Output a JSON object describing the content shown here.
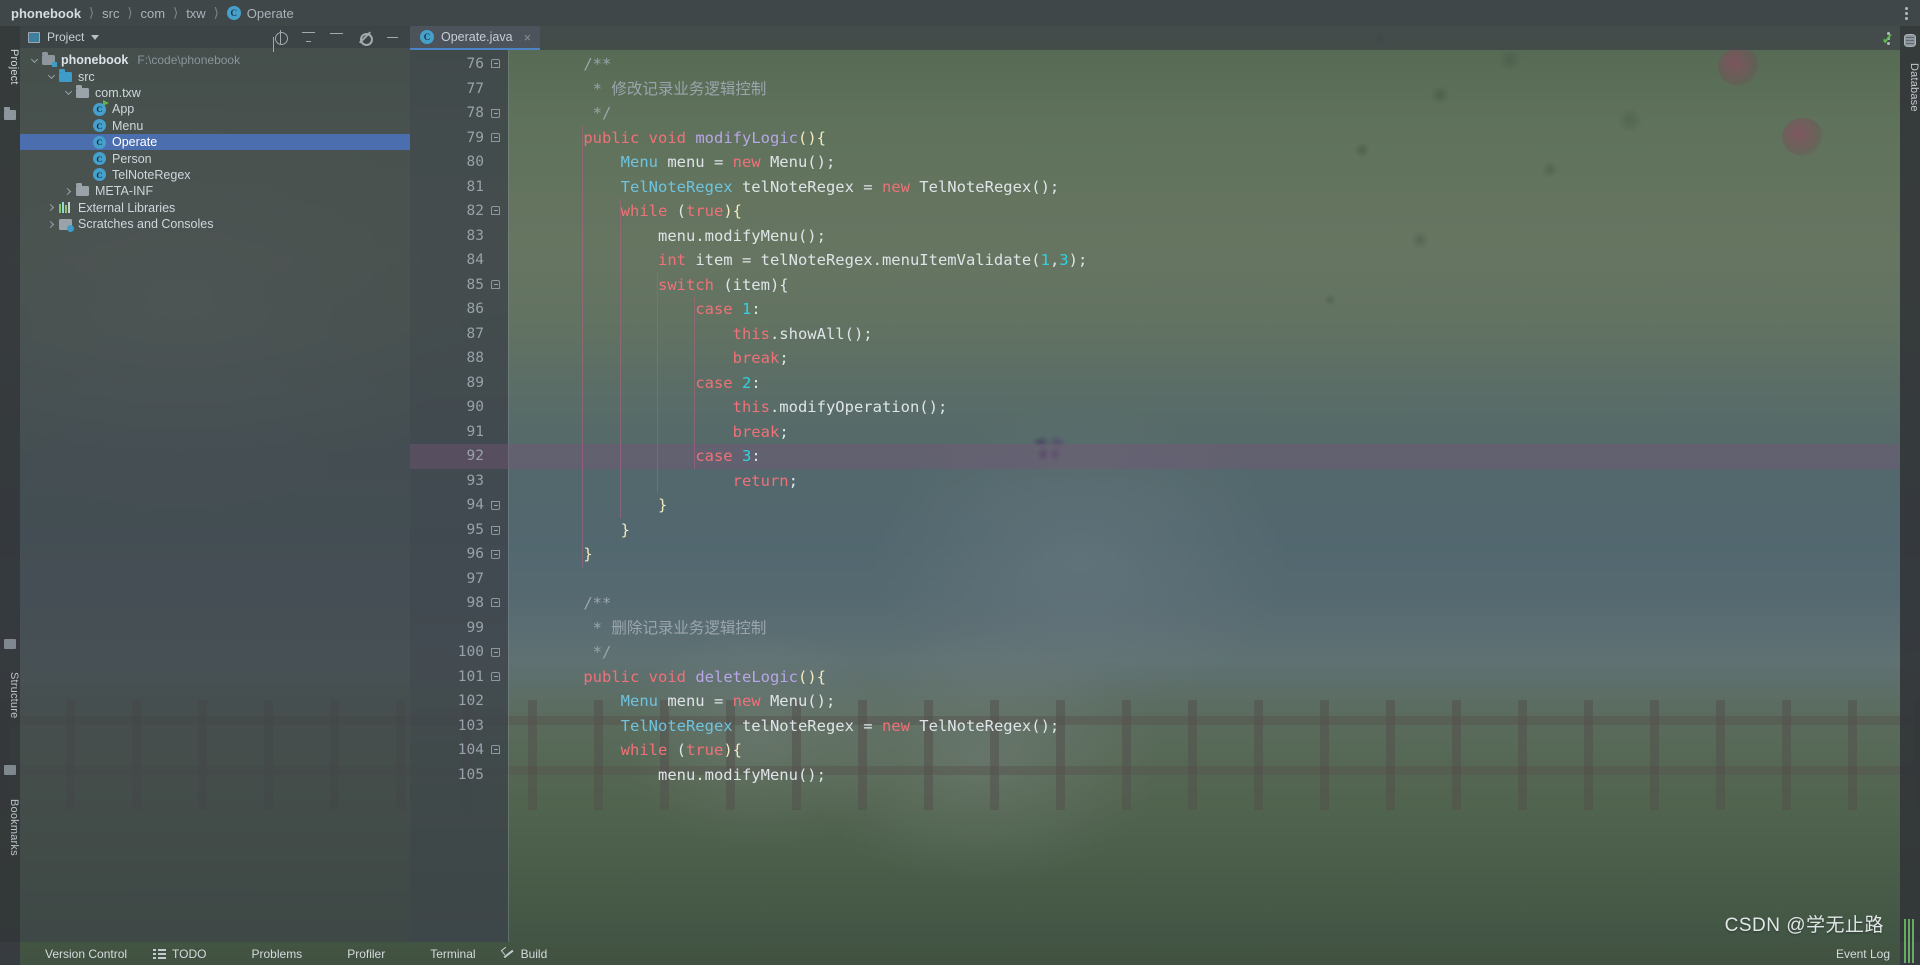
{
  "breadcrumb": {
    "items": [
      "phonebook",
      "src",
      "com",
      "txw"
    ],
    "class_item": "Operate",
    "class_icon": "class-icon"
  },
  "left_strip": {
    "project_label": "Project",
    "structure_label": "Structure",
    "bookmarks_label": "Bookmarks"
  },
  "right_strip": {
    "database_label": "Database",
    "database_icon": "database-icon"
  },
  "project_panel": {
    "title": "Project",
    "tools": [
      "locate-icon",
      "collapse-all-icon",
      "expand-icon",
      "settings-icon",
      "hide-icon"
    ],
    "tree": [
      {
        "label": "phonebook",
        "path": "F:\\code\\phonebook",
        "indent": 0,
        "twisty": "open",
        "icon": "module-folder-icon",
        "bold": true,
        "selected": false
      },
      {
        "label": "src",
        "path": "",
        "indent": 1,
        "twisty": "open",
        "icon": "source-folder-icon",
        "bold": false,
        "selected": false
      },
      {
        "label": "com.txw",
        "path": "",
        "indent": 2,
        "twisty": "open",
        "icon": "package-icon",
        "bold": false,
        "selected": false
      },
      {
        "label": "App",
        "path": "",
        "indent": 3,
        "twisty": "none",
        "icon": "class-runnable-icon",
        "bold": false,
        "selected": false
      },
      {
        "label": "Menu",
        "path": "",
        "indent": 3,
        "twisty": "none",
        "icon": "class-icon",
        "bold": false,
        "selected": false
      },
      {
        "label": "Operate",
        "path": "",
        "indent": 3,
        "twisty": "none",
        "icon": "class-icon",
        "bold": false,
        "selected": true
      },
      {
        "label": "Person",
        "path": "",
        "indent": 3,
        "twisty": "none",
        "icon": "class-icon",
        "bold": false,
        "selected": false
      },
      {
        "label": "TelNoteRegex",
        "path": "",
        "indent": 3,
        "twisty": "none",
        "icon": "class-icon",
        "bold": false,
        "selected": false
      },
      {
        "label": "META-INF",
        "path": "",
        "indent": 2,
        "twisty": "closed",
        "icon": "folder-icon",
        "bold": false,
        "selected": false
      },
      {
        "label": "External Libraries",
        "path": "",
        "indent": 1,
        "twisty": "closed",
        "icon": "libraries-icon",
        "bold": false,
        "selected": false
      },
      {
        "label": "Scratches and Consoles",
        "path": "",
        "indent": 1,
        "twisty": "closed",
        "icon": "scratches-icon",
        "bold": false,
        "selected": false
      }
    ]
  },
  "editor": {
    "tab": {
      "label": "Operate.java",
      "icon": "class-icon",
      "close": "×"
    },
    "more_icon": "more-vertical-icon",
    "inspection_status": "✓",
    "first_line_number": 76,
    "caret_line": 92,
    "lines": [
      {
        "n": 76,
        "fold": "cap-top",
        "indent": 0,
        "tokens": [
          {
            "t": "    ",
            "c": "plain"
          },
          {
            "t": "/**",
            "c": "cmt"
          }
        ]
      },
      {
        "n": 77,
        "fold": "",
        "indent": 0,
        "tokens": [
          {
            "t": "     * 修改记录业务逻辑控制",
            "c": "cmt"
          }
        ]
      },
      {
        "n": 78,
        "fold": "cap-bot",
        "indent": 0,
        "tokens": [
          {
            "t": "     */",
            "c": "cmt"
          }
        ]
      },
      {
        "n": 79,
        "fold": "cap-top",
        "indent": 0,
        "tokens": [
          {
            "t": "    ",
            "c": "plain"
          },
          {
            "t": "public",
            "c": "kw"
          },
          {
            "t": " ",
            "c": "plain"
          },
          {
            "t": "void",
            "c": "kw"
          },
          {
            "t": " ",
            "c": "plain"
          },
          {
            "t": "modifyLogic",
            "c": "mth"
          },
          {
            "t": "(){",
            "c": "brc"
          }
        ]
      },
      {
        "n": 80,
        "fold": "",
        "indent": 1,
        "tokens": [
          {
            "t": "        ",
            "c": "plain"
          },
          {
            "t": "Menu",
            "c": "cls"
          },
          {
            "t": " menu = ",
            "c": "plain"
          },
          {
            "t": "new",
            "c": "kw"
          },
          {
            "t": " Menu();",
            "c": "plain"
          }
        ]
      },
      {
        "n": 81,
        "fold": "",
        "indent": 1,
        "tokens": [
          {
            "t": "        ",
            "c": "plain"
          },
          {
            "t": "TelNoteRegex",
            "c": "cls"
          },
          {
            "t": " telNoteRegex = ",
            "c": "plain"
          },
          {
            "t": "new",
            "c": "kw"
          },
          {
            "t": " TelNoteRegex();",
            "c": "plain"
          }
        ]
      },
      {
        "n": 82,
        "fold": "cap-top",
        "indent": 1,
        "tokens": [
          {
            "t": "        ",
            "c": "plain"
          },
          {
            "t": "while",
            "c": "kw"
          },
          {
            "t": " (",
            "c": "plain"
          },
          {
            "t": "true",
            "c": "kw"
          },
          {
            "t": "){",
            "c": "brc"
          }
        ]
      },
      {
        "n": 83,
        "fold": "",
        "indent": 2,
        "tokens": [
          {
            "t": "            menu.modifyMenu();",
            "c": "plain"
          }
        ]
      },
      {
        "n": 84,
        "fold": "",
        "indent": 2,
        "tokens": [
          {
            "t": "            ",
            "c": "plain"
          },
          {
            "t": "int",
            "c": "kw"
          },
          {
            "t": " item = telNoteRegex.menuItemValidate(",
            "c": "plain"
          },
          {
            "t": "1",
            "c": "num"
          },
          {
            "t": ",",
            "c": "plain"
          },
          {
            "t": "3",
            "c": "num"
          },
          {
            "t": ");",
            "c": "plain"
          }
        ]
      },
      {
        "n": 85,
        "fold": "cap-top",
        "indent": 2,
        "tokens": [
          {
            "t": "            ",
            "c": "plain"
          },
          {
            "t": "switch",
            "c": "kw"
          },
          {
            "t": " (item){",
            "c": "plain"
          }
        ]
      },
      {
        "n": 86,
        "fold": "",
        "indent": 3,
        "tokens": [
          {
            "t": "                ",
            "c": "plain"
          },
          {
            "t": "case",
            "c": "kw"
          },
          {
            "t": " ",
            "c": "plain"
          },
          {
            "t": "1",
            "c": "num"
          },
          {
            "t": ":",
            "c": "plain"
          }
        ]
      },
      {
        "n": 87,
        "fold": "",
        "indent": 4,
        "tokens": [
          {
            "t": "                    ",
            "c": "plain"
          },
          {
            "t": "this",
            "c": "kw"
          },
          {
            "t": ".showAll();",
            "c": "plain"
          }
        ]
      },
      {
        "n": 88,
        "fold": "",
        "indent": 4,
        "tokens": [
          {
            "t": "                    ",
            "c": "plain"
          },
          {
            "t": "break",
            "c": "kw"
          },
          {
            "t": ";",
            "c": "plain"
          }
        ]
      },
      {
        "n": 89,
        "fold": "",
        "indent": 3,
        "tokens": [
          {
            "t": "                ",
            "c": "plain"
          },
          {
            "t": "case",
            "c": "kw"
          },
          {
            "t": " ",
            "c": "plain"
          },
          {
            "t": "2",
            "c": "num"
          },
          {
            "t": ":",
            "c": "plain"
          }
        ]
      },
      {
        "n": 90,
        "fold": "",
        "indent": 4,
        "tokens": [
          {
            "t": "                    ",
            "c": "plain"
          },
          {
            "t": "this",
            "c": "kw"
          },
          {
            "t": ".modifyOperation();",
            "c": "plain"
          }
        ]
      },
      {
        "n": 91,
        "fold": "",
        "indent": 4,
        "tokens": [
          {
            "t": "                    ",
            "c": "plain"
          },
          {
            "t": "break",
            "c": "kw"
          },
          {
            "t": ";",
            "c": "plain"
          }
        ]
      },
      {
        "n": 92,
        "fold": "",
        "indent": 3,
        "tokens": [
          {
            "t": "                ",
            "c": "plain"
          },
          {
            "t": "case",
            "c": "kw"
          },
          {
            "t": " ",
            "c": "plain"
          },
          {
            "t": "3",
            "c": "num"
          },
          {
            "t": ":",
            "c": "plain"
          }
        ]
      },
      {
        "n": 93,
        "fold": "",
        "indent": 4,
        "tokens": [
          {
            "t": "                    ",
            "c": "plain"
          },
          {
            "t": "return",
            "c": "kw"
          },
          {
            "t": ";",
            "c": "plain"
          }
        ]
      },
      {
        "n": 94,
        "fold": "cap-bot",
        "indent": 2,
        "tokens": [
          {
            "t": "            }",
            "c": "brc"
          }
        ]
      },
      {
        "n": 95,
        "fold": "cap-bot",
        "indent": 1,
        "tokens": [
          {
            "t": "        }",
            "c": "brc"
          }
        ]
      },
      {
        "n": 96,
        "fold": "cap-bot",
        "indent": 0,
        "tokens": [
          {
            "t": "    }",
            "c": "brc"
          }
        ]
      },
      {
        "n": 97,
        "fold": "",
        "indent": 0,
        "tokens": [
          {
            "t": "",
            "c": "plain"
          }
        ]
      },
      {
        "n": 98,
        "fold": "cap-top",
        "indent": 0,
        "tokens": [
          {
            "t": "    ",
            "c": "plain"
          },
          {
            "t": "/**",
            "c": "cmt"
          }
        ]
      },
      {
        "n": 99,
        "fold": "",
        "indent": 0,
        "tokens": [
          {
            "t": "     * 删除记录业务逻辑控制",
            "c": "cmt"
          }
        ]
      },
      {
        "n": 100,
        "fold": "cap-bot",
        "indent": 0,
        "tokens": [
          {
            "t": "     */",
            "c": "cmt"
          }
        ]
      },
      {
        "n": 101,
        "fold": "cap-top",
        "indent": 0,
        "tokens": [
          {
            "t": "    ",
            "c": "plain"
          },
          {
            "t": "public",
            "c": "kw"
          },
          {
            "t": " ",
            "c": "plain"
          },
          {
            "t": "void",
            "c": "kw"
          },
          {
            "t": " ",
            "c": "plain"
          },
          {
            "t": "deleteLogic",
            "c": "mth"
          },
          {
            "t": "(){",
            "c": "brc"
          }
        ]
      },
      {
        "n": 102,
        "fold": "",
        "indent": 1,
        "tokens": [
          {
            "t": "        ",
            "c": "plain"
          },
          {
            "t": "Menu",
            "c": "cls"
          },
          {
            "t": " menu = ",
            "c": "plain"
          },
          {
            "t": "new",
            "c": "kw"
          },
          {
            "t": " Menu();",
            "c": "plain"
          }
        ]
      },
      {
        "n": 103,
        "fold": "",
        "indent": 1,
        "tokens": [
          {
            "t": "        ",
            "c": "plain"
          },
          {
            "t": "TelNoteRegex",
            "c": "cls"
          },
          {
            "t": " telNoteRegex = ",
            "c": "plain"
          },
          {
            "t": "new",
            "c": "kw"
          },
          {
            "t": " TelNoteRegex();",
            "c": "plain"
          }
        ]
      },
      {
        "n": 104,
        "fold": "cap-top",
        "indent": 1,
        "tokens": [
          {
            "t": "        ",
            "c": "plain"
          },
          {
            "t": "while",
            "c": "kw"
          },
          {
            "t": " (",
            "c": "plain"
          },
          {
            "t": "true",
            "c": "kw"
          },
          {
            "t": "){",
            "c": "brc"
          }
        ]
      },
      {
        "n": 105,
        "fold": "",
        "indent": 2,
        "tokens": [
          {
            "t": "            menu.modifyMenu();",
            "c": "plain"
          }
        ]
      }
    ]
  },
  "statusbar": {
    "items": [
      {
        "label": "Version Control",
        "icon": "branch-icon"
      },
      {
        "label": "TODO",
        "icon": "todo-icon"
      },
      {
        "label": "Problems",
        "icon": "problems-icon"
      },
      {
        "label": "Profiler",
        "icon": "profiler-icon"
      },
      {
        "label": "Terminal",
        "icon": "terminal-icon"
      },
      {
        "label": "Build",
        "icon": "build-icon"
      }
    ],
    "event_log": "Event Log"
  },
  "watermark": {
    "text": "CSDN @学无止路"
  },
  "colors": {
    "selection": "#4b6eaf",
    "accent": "#46a0cc",
    "keyword": "#f07178",
    "class": "#6fc3df",
    "method": "#b8a6e8",
    "number": "#2dd4e0",
    "comment": "#9aa5ad",
    "brace": "#f2eac0",
    "caret_line": "#785676",
    "tab_underline": "#4b83c4"
  }
}
